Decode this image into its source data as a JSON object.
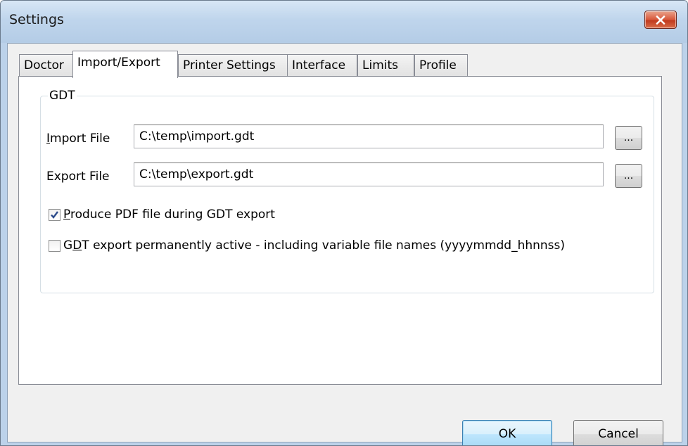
{
  "window": {
    "title": "Settings",
    "close_icon": "close-x-icon"
  },
  "tabs": [
    {
      "label": "Doctor",
      "active": false
    },
    {
      "label": "Import/Export",
      "active": true
    },
    {
      "label": "Printer Settings",
      "active": false
    },
    {
      "label": "Interface",
      "active": false
    },
    {
      "label": "Limits",
      "active": false
    },
    {
      "label": "Profile",
      "active": false
    }
  ],
  "gdt": {
    "group_label": "GDT",
    "import_file": {
      "label_first": "I",
      "label_rest": "mport File",
      "value": "C:\\temp\\import.gdt",
      "browse_label": "..."
    },
    "export_file": {
      "label": "Export File",
      "value": "C:\\temp\\export.gdt",
      "browse_label": "..."
    },
    "produce_pdf": {
      "label_first": "P",
      "label_rest": "roduce PDF file during GDT export",
      "checked": true
    },
    "permanent_export": {
      "label_a": "G",
      "label_b": "D",
      "label_c": "T export permanently active - including variable file names (yyyymmdd_hhnnss)",
      "checked": false
    }
  },
  "buttons": {
    "ok": "OK",
    "cancel": "Cancel"
  },
  "colors": {
    "title_bar": "#bfd5ec",
    "close_button": "#d8573a",
    "default_button": "#bee6fd",
    "check_mark": "#2b4a8b"
  }
}
